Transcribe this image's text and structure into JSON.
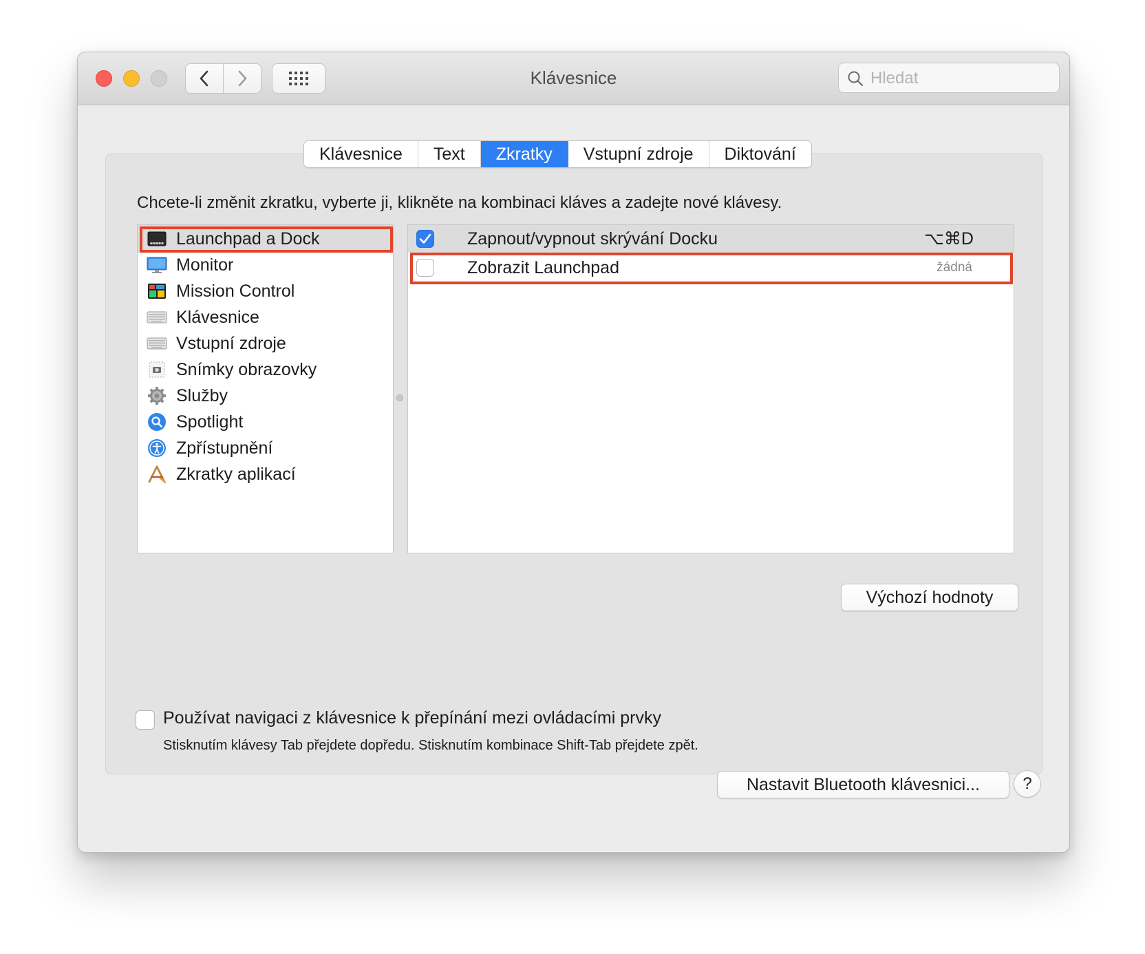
{
  "window": {
    "title": "Klávesnice",
    "search_placeholder": "Hledat"
  },
  "tabs": [
    {
      "label": "Klávesnice",
      "active": false
    },
    {
      "label": "Text",
      "active": false
    },
    {
      "label": "Zkratky",
      "active": true
    },
    {
      "label": "Vstupní zdroje",
      "active": false
    },
    {
      "label": "Diktování",
      "active": false
    }
  ],
  "instructions": "Chcete-li změnit zkratku, vyberte ji, klikněte na kombinaci kláves a zadejte nové klávesy.",
  "categories": [
    {
      "label": "Launchpad a Dock",
      "icon": "launchpad-dock-icon",
      "selected": true
    },
    {
      "label": "Monitor",
      "icon": "monitor-icon",
      "selected": false
    },
    {
      "label": "Mission Control",
      "icon": "mission-control-icon",
      "selected": false
    },
    {
      "label": "Klávesnice",
      "icon": "keyboard-icon",
      "selected": false
    },
    {
      "label": "Vstupní zdroje",
      "icon": "input-sources-icon",
      "selected": false
    },
    {
      "label": "Snímky obrazovky",
      "icon": "screenshot-icon",
      "selected": false
    },
    {
      "label": "Služby",
      "icon": "services-gear-icon",
      "selected": false
    },
    {
      "label": "Spotlight",
      "icon": "spotlight-icon",
      "selected": false
    },
    {
      "label": "Zpřístupnění",
      "icon": "accessibility-icon",
      "selected": false
    },
    {
      "label": "Zkratky aplikací",
      "icon": "app-shortcuts-icon",
      "selected": false
    }
  ],
  "shortcuts": [
    {
      "label": "Zapnout/vypnout skrývání Docku",
      "key": "⌥⌘D",
      "checked": true
    },
    {
      "label": "Zobrazit Launchpad",
      "key": "žádná",
      "checked": false
    }
  ],
  "buttons": {
    "defaults": "Výchozí hodnoty",
    "bluetooth": "Nastavit Bluetooth klávesnici...",
    "help": "?"
  },
  "keyboard_navigation": {
    "checked": false,
    "label": "Používat navigaci z klávesnice k přepínání mezi ovládacími prvky",
    "help_text": "Stisknutím klávesy Tab přejdete dopředu. Stisknutím kombinace Shift-Tab přejdete zpět."
  },
  "colors": {
    "accent": "#2d7ff3",
    "highlight_annotation": "#e0442b"
  }
}
